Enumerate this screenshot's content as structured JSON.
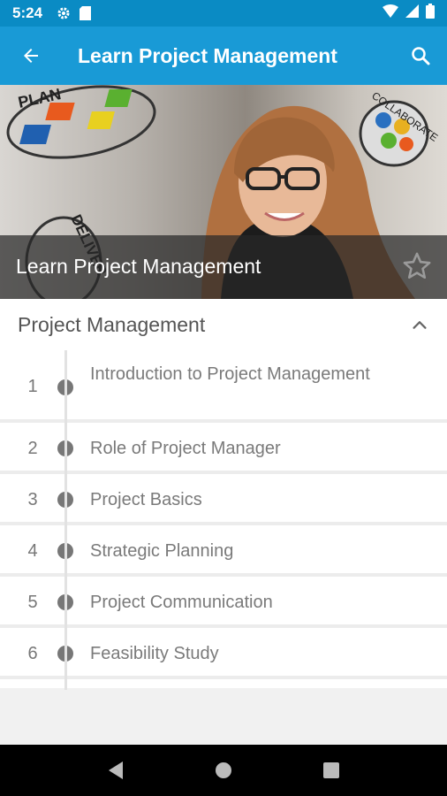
{
  "status_bar": {
    "time": "5:24",
    "icons": [
      "settings-icon",
      "sd-card-icon",
      "wifi-icon",
      "signal-icon",
      "battery-icon"
    ]
  },
  "app_bar": {
    "title": "Learn Project Management",
    "back_icon": "arrow-left-icon",
    "search_icon": "search-icon"
  },
  "hero": {
    "title": "Learn Project Management",
    "favorite_icon": "star-outline-icon",
    "image_text": {
      "plan": "PLAN",
      "deliver": "DELIVER",
      "collaborate": "COLLABORATE"
    }
  },
  "section": {
    "label": "Project Management",
    "toggle_icon": "chevron-up-icon"
  },
  "lessons": [
    {
      "number": "1",
      "title": "Introduction to Project Management"
    },
    {
      "number": "2",
      "title": "Role of Project Manager"
    },
    {
      "number": "3",
      "title": "Project Basics"
    },
    {
      "number": "4",
      "title": "Strategic Planning"
    },
    {
      "number": "5",
      "title": "Project Communication"
    },
    {
      "number": "6",
      "title": "Feasibility Study"
    }
  ],
  "nav_bar": {
    "icons": [
      "back-triangle-icon",
      "home-circle-icon",
      "recents-square-icon"
    ]
  },
  "colors": {
    "status_bar": "#0a8bc4",
    "app_bar": "#199ad6",
    "dot": "#777777"
  }
}
